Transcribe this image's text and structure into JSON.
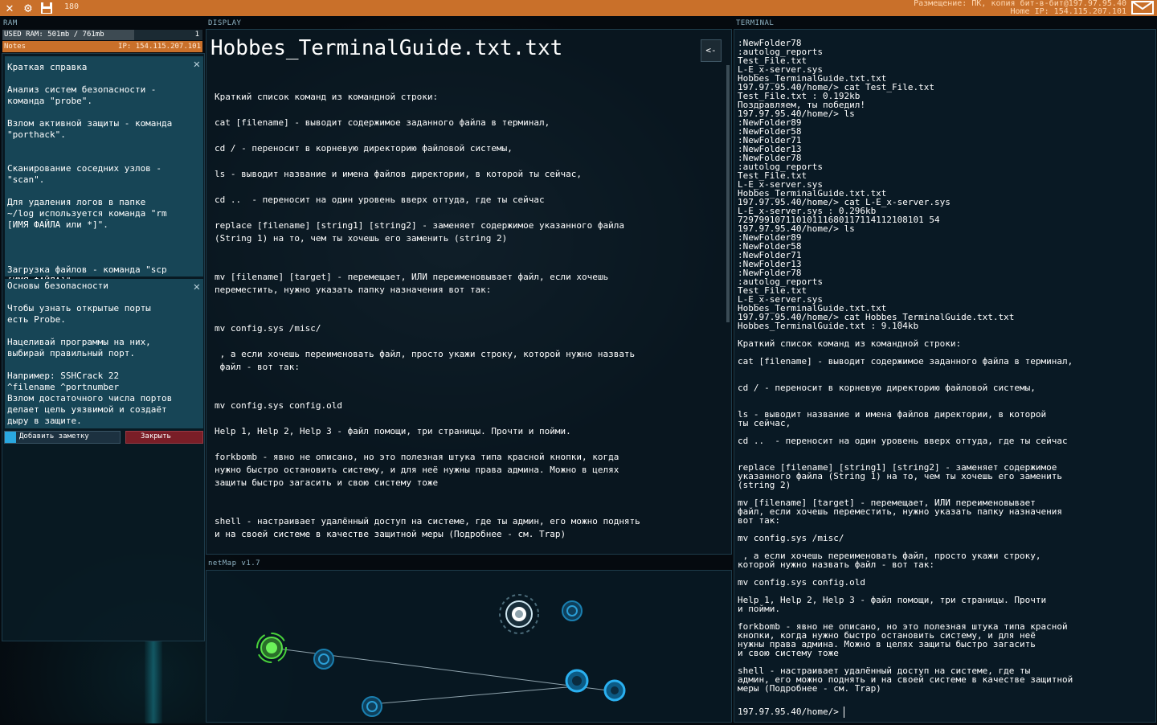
{
  "topbar": {
    "icons": [
      "close-icon",
      "gear-icon",
      "save-icon"
    ],
    "count": "180",
    "location_line1": "Размещение: ПК, копия бит-в-бит@197.97.95.40",
    "location_line2": "Home IP: 154.115.207.101",
    "mail_icon": "mail-icon",
    "color": "#c9702a"
  },
  "ram": {
    "label": "RAM",
    "used_text": "USED RAM: 501mb / 761mb",
    "used_fraction": 0.66,
    "count": "1"
  },
  "notes_bar": {
    "label": "Notes",
    "ip": "IP: 154.115.207.101"
  },
  "notes": [
    {
      "title": "Краткая справка",
      "body": "Анализ систем безопасности -\nкоманда \"probe\".\n\nВзлом активной защиты - команда\n\"porthack\".\n\n\nСканирование соседних узлов -\n\"scan\".\n\nДля удаления логов в папке\n~/log используется команда \"rm\n[ИМЯ ФАЙЛА или *]\".\n\n\n\nЗагрузка файлов - команда \"scp\n[ИМЯ ФАЙЛА]\""
    },
    {
      "title": "Основы безопасности",
      "body": "Чтобы узнать открытые порты\nесть Probe.\n\nНацеливай программы на них,\nвыбирай правильный порт.\n\nНапример: SSHCrack 22\n^filename ^portnumber\nВзлом достаточного числа портов\nделает цель уязвимой и создаёт\nдыру в защите."
    }
  ],
  "note_buttons": {
    "add": "Добавить заметку",
    "close": "Закрыть"
  },
  "display": {
    "label": "DISPLAY",
    "title": "Hobbes_TerminalGuide.txt.txt",
    "back": "<-",
    "body": "Краткий список команд из командной строки:\n\ncat [filename] - выводит содержимое заданного файла в терминал,\n\ncd / - переносит в корневую директорию файловой системы,\n\nls - выводит название и имена файлов директории, в которой ты сейчас,\n\ncd ..  - переносит на один уровень вверх оттуда, где ты сейчас\n\nreplace [filename] [string1] [string2] - заменяет содержимое указанного файла\n(String 1) на то, чем ты хочешь его заменить (string 2)\n\n\nmv [filename] [target] - перемещает, ИЛИ переименовывает файл, если хочешь\nпереместить, нужно указать папку назначения вот так:\n\n\nmv config.sys /misc/\n\n , а если хочешь переименовать файл, просто укажи строку, которой нужно назвать\n файл - вот так:\n\n\nmv config.sys config.old\n\nHelp 1, Help 2, Help 3 - файл помощи, три страницы. Прочти и пойми.\n\nforkbomb - явно не описано, но это полезная штука типа красной кнопки, когда\nнужно быстро остановить систему, и для неё нужны права админа. Можно в целях\nзащиты быстро загасить и свою систему тоже\n\n\nshell - настраивает удалённый доступ на системе, где ты админ, его можно поднять\nи на своей системе в качестве защитной меры (Подробнее - см. Trap)"
  },
  "netmap": {
    "label": "netMap v1.7",
    "nodes": [
      {
        "kind": "home",
        "color": "#48d13a"
      },
      {
        "kind": "node",
        "color": "#1a7fb0"
      },
      {
        "kind": "node",
        "color": "#1a7fb0"
      },
      {
        "kind": "current",
        "color": "#ffffff"
      },
      {
        "kind": "node",
        "color": "#1a7fb0"
      },
      {
        "kind": "node-active",
        "color": "#2ab0f0"
      },
      {
        "kind": "node-active",
        "color": "#2ab0f0"
      }
    ]
  },
  "terminal": {
    "label": "TERMINAL",
    "body": ":NewFolder78\n:autolog_reports\nTest_File.txt\nL-E_x-server.sys\nHobbes_TerminalGuide.txt.txt\n197.97.95.40/home/> cat Test_File.txt\nTest_File.txt : 0.192kb\nПоздравляем, ты победил!\n197.97.95.40/home/> ls\n:NewFolder89\n:NewFolder58\n:NewFolder71\n:NewFolder13\n:NewFolder78\n:autolog_reports\nTest_File.txt\nL-E_x-server.sys\nHobbes_TerminalGuide.txt.txt\n197.97.95.40/home/> cat L-E_x-server.sys\nL-E_x-server.sys : 0.296kb\n72979910711010111680117114112108101 54\n197.97.95.40/home/> ls\n:NewFolder89\n:NewFolder58\n:NewFolder71\n:NewFolder13\n:NewFolder78\n:autolog_reports\nTest_File.txt\nL-E_x-server.sys\nHobbes_TerminalGuide.txt.txt\n197.97.95.40/home/> cat Hobbes_TerminalGuide.txt.txt\nHobbes_TerminalGuide.txt : 9.104kb\n\nКраткий список команд из командной строки:\n\ncat [filename] - выводит содержимое заданного файла в терминал,\n\n\ncd / - переносит в корневую директорию файловой системы,\n\n\nls - выводит название и имена файлов директории, в которой\nты сейчас,\n\ncd ..  - переносит на один уровень вверх оттуда, где ты сейчас\n\n\nreplace [filename] [string1] [string2] - заменяет содержимое\nуказанного файла (String 1) на то, чем ты хочешь его заменить\n(string 2)\n\nmv [filename] [target] - перемещает, ИЛИ переименовывает\nфайл, если хочешь переместить, нужно указать папку назначения\nвот так:\n\nmv config.sys /misc/\n\n , а если хочешь переименовать файл, просто укажи строку,\nкоторой нужно назвать файл - вот так:\n\nmv config.sys config.old\n\nHelp 1, Help 2, Help 3 - файл помощи, три страницы. Прочти\nи пойми.\n\nforkbomb - явно не описано, но это полезная штука типа красной\nкнопки, когда нужно быстро остановить систему, и для неё\nнужны права админа. Можно в целях защиты быстро загасить\nи свою систему тоже\n\nshell - настраивает удалённый доступ на системе, где ты\nадмин, его можно поднять и на своей системе в качестве защитной\nмеры (Подробнее - см. Trap)",
    "prompt": "197.97.95.40/home/>"
  }
}
